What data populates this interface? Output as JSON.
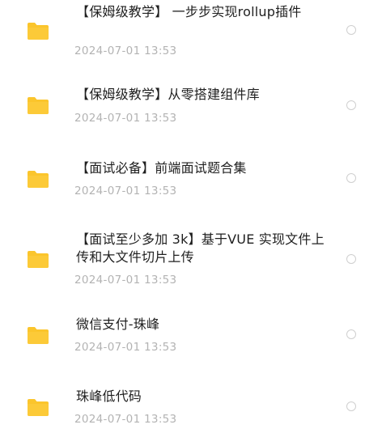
{
  "files": [
    {
      "name": "【保姆级教学】 一步步实现rollup插件",
      "date": "2024-07-01  13:53",
      "icon": "folder-icon"
    },
    {
      "name": "【保姆级教学】从零搭建组件库",
      "date": "2024-07-01  13:53",
      "icon": "folder-icon"
    },
    {
      "name": "【面试必备】前端面试题合集",
      "date": "2024-07-01  13:53",
      "icon": "folder-icon"
    },
    {
      "name": "【面试至少多加 3k】基于VUE 实现文件上传和大文件切片上传",
      "date": "2024-07-01  13:53",
      "icon": "folder-icon"
    },
    {
      "name": "微信支付-珠峰",
      "date": "2024-07-01  13:53",
      "icon": "folder-icon"
    },
    {
      "name": "珠峰低代码",
      "date": "2024-07-01  13:53",
      "icon": "folder-icon"
    }
  ],
  "colors": {
    "folder": "#fbc52c",
    "folder_dark": "#f2b51e",
    "title_text": "#1f1f1f",
    "date_text": "#b3b3b3",
    "radio_border": "#cfcfcf"
  }
}
